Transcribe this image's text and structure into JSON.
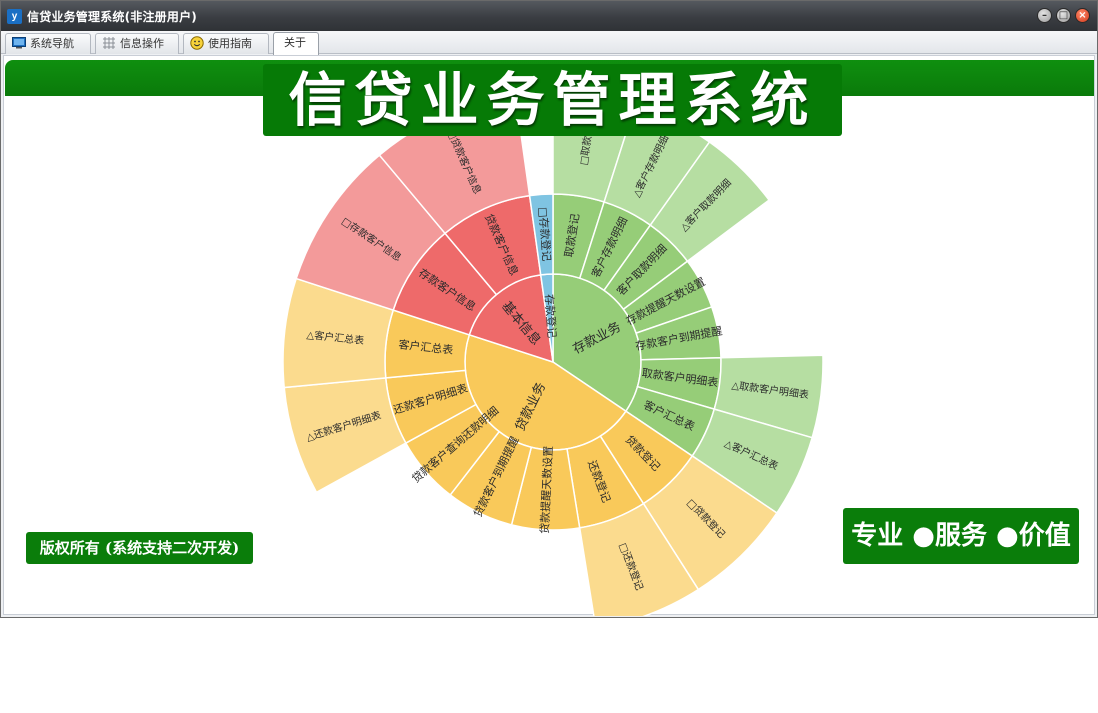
{
  "window": {
    "title": "信贷业务管理系统(非注册用户)",
    "controls": {
      "minimize": "–",
      "maximize": "□",
      "close": "×"
    }
  },
  "tabs": [
    {
      "label": "系统导航",
      "icon": "monitor-icon",
      "active": false
    },
    {
      "label": "信息操作",
      "icon": "grid-icon",
      "active": false
    },
    {
      "label": "使用指南",
      "icon": "smiley-icon",
      "active": false
    },
    {
      "label": "关于",
      "icon": "",
      "active": true
    }
  ],
  "banner": {
    "title": "信贷业务管理系统",
    "copyright": "版权所有 (系统支持二次开发)",
    "slogan": "专业 ●服务 ●价值"
  },
  "colors": {
    "banner_green": "#0a7d0a",
    "deposit": "#96cd78",
    "deposit_light": "#b6dea2",
    "loan": "#f9c95a",
    "loan_light": "#fbdb8e",
    "basic": "#ee6a6a",
    "basic_light": "#f39a9a",
    "register": "#7fc4e2"
  },
  "chart_data": {
    "type": "sunburst",
    "center_label": "",
    "rings": [
      {
        "level": 1,
        "segments": [
          {
            "label": "存款业务",
            "share": 0.34,
            "group": "deposit"
          },
          {
            "label": "贷款业务",
            "share": 0.45,
            "group": "loan"
          },
          {
            "label": "基本信息",
            "share": 0.18,
            "group": "basic"
          },
          {
            "label": "存款登记",
            "share": 0.03,
            "group": "register"
          }
        ]
      }
    ],
    "nodes": {
      "存款业务": {
        "children": [
          "客户汇总表",
          "取款客户明细表",
          "存款客户到期提醒",
          "存款提醒天数设置",
          "客户取款明细",
          "客户存款明细",
          "取款登记"
        ],
        "leaves": {
          "客户汇总表": [
            "△客户汇总表"
          ],
          "取款客户明细表": [
            "△取款客户明细表"
          ],
          "客户取款明细": [
            "△客户取款明细"
          ],
          "客户存款明细": [
            "△客户存款明细"
          ],
          "取款登记": [
            "□取款登"
          ]
        }
      },
      "贷款业务": {
        "children": [
          "贷款登记",
          "还款登记",
          "贷款提醒天数设置",
          "贷款客户到期提醒",
          "贷款客户查询还款明细",
          "还款客户明细表",
          "客户汇总表"
        ],
        "leaves": {
          "贷款登记": [
            "□贷款登记"
          ],
          "还款登记": [
            "□还款登记"
          ],
          "还款客户明细表": [
            "△还款客户明细表"
          ],
          "客户汇总表": [
            "△客户汇总表"
          ]
        }
      },
      "基本信息": {
        "children": [
          "存款客户信息",
          "贷款客户信息"
        ],
        "leaves": {
          "存款客户信息": [
            "□存款客户信息"
          ],
          "贷款客户信息": [
            "□贷款客户信息"
          ]
        }
      },
      "存款登记": {
        "children": [
          "□存款登记"
        ]
      }
    }
  }
}
